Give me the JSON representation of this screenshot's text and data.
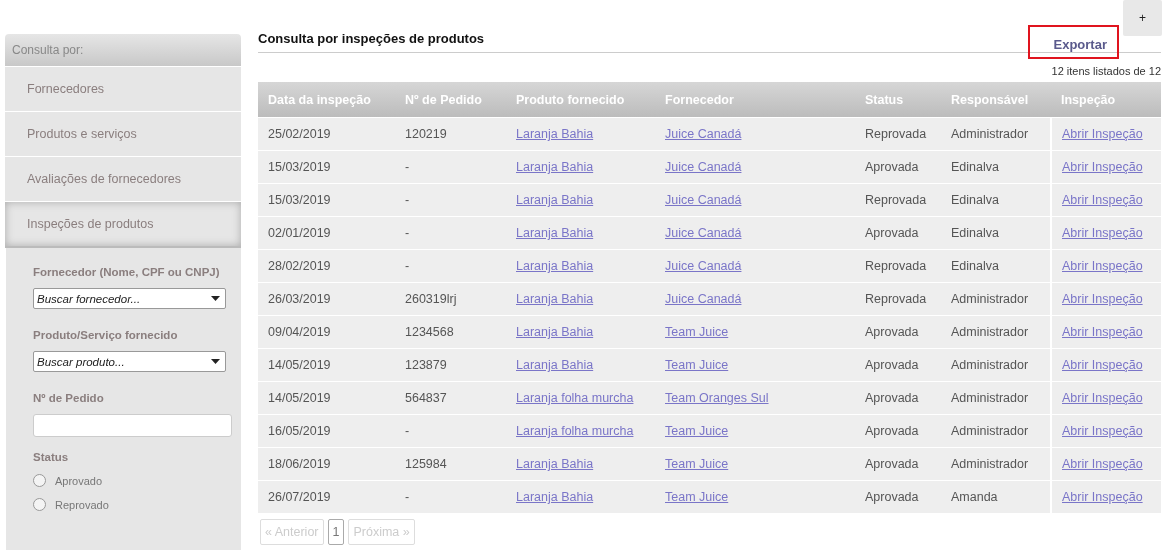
{
  "sidebar": {
    "header": "Consulta por:",
    "items": [
      {
        "label": "Fornecedores",
        "selected": false
      },
      {
        "label": "Produtos e serviços",
        "selected": false
      },
      {
        "label": "Avaliações de fornecedores",
        "selected": false
      },
      {
        "label": "Inspeções de produtos",
        "selected": true
      }
    ],
    "filters": [
      {
        "kind": "select",
        "label": "Fornecedor (Nome, CPF ou CNPJ)",
        "placeholder": "Buscar fornecedor..."
      },
      {
        "kind": "select",
        "label": "Produto/Serviço fornecido",
        "placeholder": "Buscar produto..."
      },
      {
        "kind": "text",
        "label": "Nº de Pedido"
      },
      {
        "kind": "radio",
        "label": "Status",
        "options": [
          {
            "label": "Aprovado",
            "checked": false
          },
          {
            "label": "Reprovado",
            "checked": false
          }
        ]
      }
    ]
  },
  "page": {
    "title": "Consulta por inspeções de produtos",
    "add_button": "+",
    "export": {
      "label": "Exportar",
      "highlighted": true
    },
    "count": "12 itens listados de 12"
  },
  "table": {
    "columns": [
      "Data da inspeção",
      "Nº de Pedido",
      "Produto fornecido",
      "Fornecedor",
      "Status",
      "Responsável",
      "Inspeção"
    ],
    "rows": [
      [
        "25/02/2019",
        "120219",
        "Laranja Bahia",
        "Juice Canadá",
        "Reprovada",
        "Administrador",
        "Abrir Inspeção"
      ],
      [
        "15/03/2019",
        "-",
        "Laranja Bahia",
        "Juice Canadá",
        "Aprovada",
        "Edinalva",
        "Abrir Inspeção"
      ],
      [
        "15/03/2019",
        "-",
        "Laranja Bahia",
        "Juice Canadá",
        "Reprovada",
        "Edinalva",
        "Abrir Inspeção"
      ],
      [
        "02/01/2019",
        "-",
        "Laranja Bahia",
        "Juice Canadá",
        "Aprovada",
        "Edinalva",
        "Abrir Inspeção"
      ],
      [
        "28/02/2019",
        "-",
        "Laranja Bahia",
        "Juice Canadá",
        "Reprovada",
        "Edinalva",
        "Abrir Inspeção"
      ],
      [
        "26/03/2019",
        "260319lrj",
        "Laranja Bahia",
        "Juice Canadá",
        "Reprovada",
        "Administrador",
        "Abrir Inspeção"
      ],
      [
        "09/04/2019",
        "1234568",
        "Laranja Bahia",
        "Team Juice",
        "Aprovada",
        "Administrador",
        "Abrir Inspeção"
      ],
      [
        "14/05/2019",
        "123879",
        "Laranja Bahia",
        "Team Juice",
        "Aprovada",
        "Administrador",
        "Abrir Inspeção"
      ],
      [
        "14/05/2019",
        "564837",
        "Laranja folha murcha",
        "Team Oranges Sul",
        "Aprovada",
        "Administrador",
        "Abrir Inspeção"
      ],
      [
        "16/05/2019",
        "-",
        "Laranja folha murcha",
        "Team Juice",
        "Aprovada",
        "Administrador",
        "Abrir Inspeção"
      ],
      [
        "18/06/2019",
        "125984",
        "Laranja Bahia",
        "Team Juice",
        "Aprovada",
        "Administrador",
        "Abrir Inspeção"
      ],
      [
        "26/07/2019",
        "-",
        "Laranja Bahia",
        "Team Juice",
        "Aprovada",
        "Amanda",
        "Abrir Inspeção"
      ]
    ]
  },
  "pagination": [
    {
      "label": "« Anterior",
      "disabled": true,
      "selected": false
    },
    {
      "label": "1",
      "disabled": false,
      "selected": true
    },
    {
      "label": "Próxima »",
      "disabled": true,
      "selected": false
    }
  ]
}
